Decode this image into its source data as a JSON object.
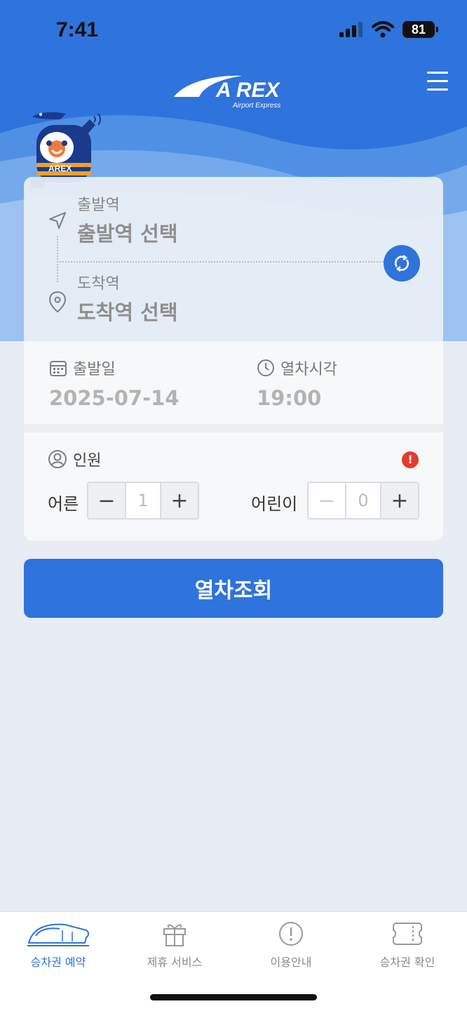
{
  "status_bar": {
    "time": "7:41",
    "battery": "81"
  },
  "header": {
    "logo_text": "A REX",
    "logo_sub": "Airport Express",
    "mascot_badge": "AREX"
  },
  "route": {
    "departure_label": "출발역",
    "departure_value": "출발역 선택",
    "arrival_label": "도착역",
    "arrival_value": "도착역 선택"
  },
  "date": {
    "label": "출발일",
    "value": "2025-07-14"
  },
  "time": {
    "label": "열차시각",
    "value": "19:00"
  },
  "passengers": {
    "label": "인원",
    "alert": "!",
    "adult_label": "어른",
    "adult_count": "1",
    "child_label": "어린이",
    "child_count": "0",
    "minus": "−",
    "plus": "+"
  },
  "search_button": "열차조회",
  "tabs": [
    {
      "label": "승차권 예약",
      "icon": "train-icon",
      "active": true
    },
    {
      "label": "제휴 서비스",
      "icon": "gift-icon",
      "active": false
    },
    {
      "label": "이용안내",
      "icon": "info-icon",
      "active": false
    },
    {
      "label": "승차권 확인",
      "icon": "ticket-icon",
      "active": false
    }
  ],
  "colors": {
    "primary": "#2f73dc",
    "alert": "#e53b2c",
    "background": "#e8ecf3"
  }
}
